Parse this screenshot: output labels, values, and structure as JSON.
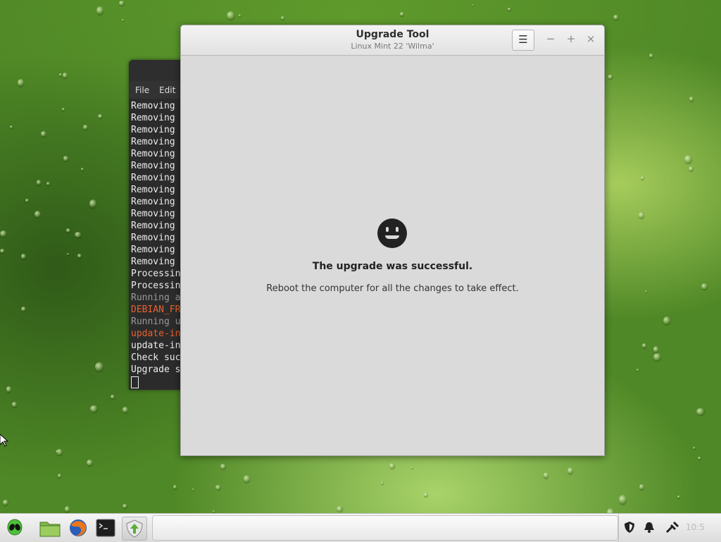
{
  "terminal": {
    "menu": [
      "File",
      "Edit"
    ],
    "lines": [
      {
        "text": "Removing",
        "color": "default"
      },
      {
        "text": "Removing",
        "color": "default"
      },
      {
        "text": "Removing",
        "color": "default"
      },
      {
        "text": "Removing",
        "color": "default"
      },
      {
        "text": "Removing",
        "color": "default"
      },
      {
        "text": "Removing",
        "color": "default"
      },
      {
        "text": "Removing",
        "color": "default"
      },
      {
        "text": "Removing",
        "color": "default"
      },
      {
        "text": "Removing",
        "color": "default"
      },
      {
        "text": "Removing",
        "color": "default"
      },
      {
        "text": "Removing",
        "color": "default"
      },
      {
        "text": "Removing",
        "color": "default"
      },
      {
        "text": "Removing",
        "color": "default"
      },
      {
        "text": "Removing",
        "color": "default"
      },
      {
        "text": "Processin",
        "color": "default"
      },
      {
        "text": "Processin",
        "color": "default"
      },
      {
        "text": "Running a",
        "color": "gray"
      },
      {
        "text": "DEBIAN_FR",
        "color": "orange"
      },
      {
        "text": "Running u",
        "color": "gray"
      },
      {
        "text": "update-in",
        "color": "orange"
      },
      {
        "text": "update-in",
        "color": "default"
      },
      {
        "text": "Check suc",
        "color": "default"
      },
      {
        "text": "Upgrade s",
        "color": "default"
      }
    ]
  },
  "window": {
    "title": "Upgrade Tool",
    "subtitle": "Linux Mint 22 'Wilma'",
    "menu_button_glyph": "☰",
    "minimize_glyph": "−",
    "maximize_glyph": "+",
    "close_glyph": "×",
    "status_icon": "smiley-face-icon",
    "message_title": "The upgrade was successful.",
    "message_body": "Reboot the computer for all the changes to take effect."
  },
  "taskbar": {
    "launchers": [
      "mint-menu-icon",
      "folder-icon",
      "firefox-icon",
      "terminal-icon",
      "update-manager-icon"
    ],
    "tray": [
      "shield-icon",
      "notification-bell-icon",
      "network-icon"
    ],
    "clock": "10:5"
  },
  "colors": {
    "desktop": "#4f8826",
    "terminal_bg": "#2b2b2b",
    "terminal_orange": "#e8622c",
    "window_bg": "#dadada"
  }
}
